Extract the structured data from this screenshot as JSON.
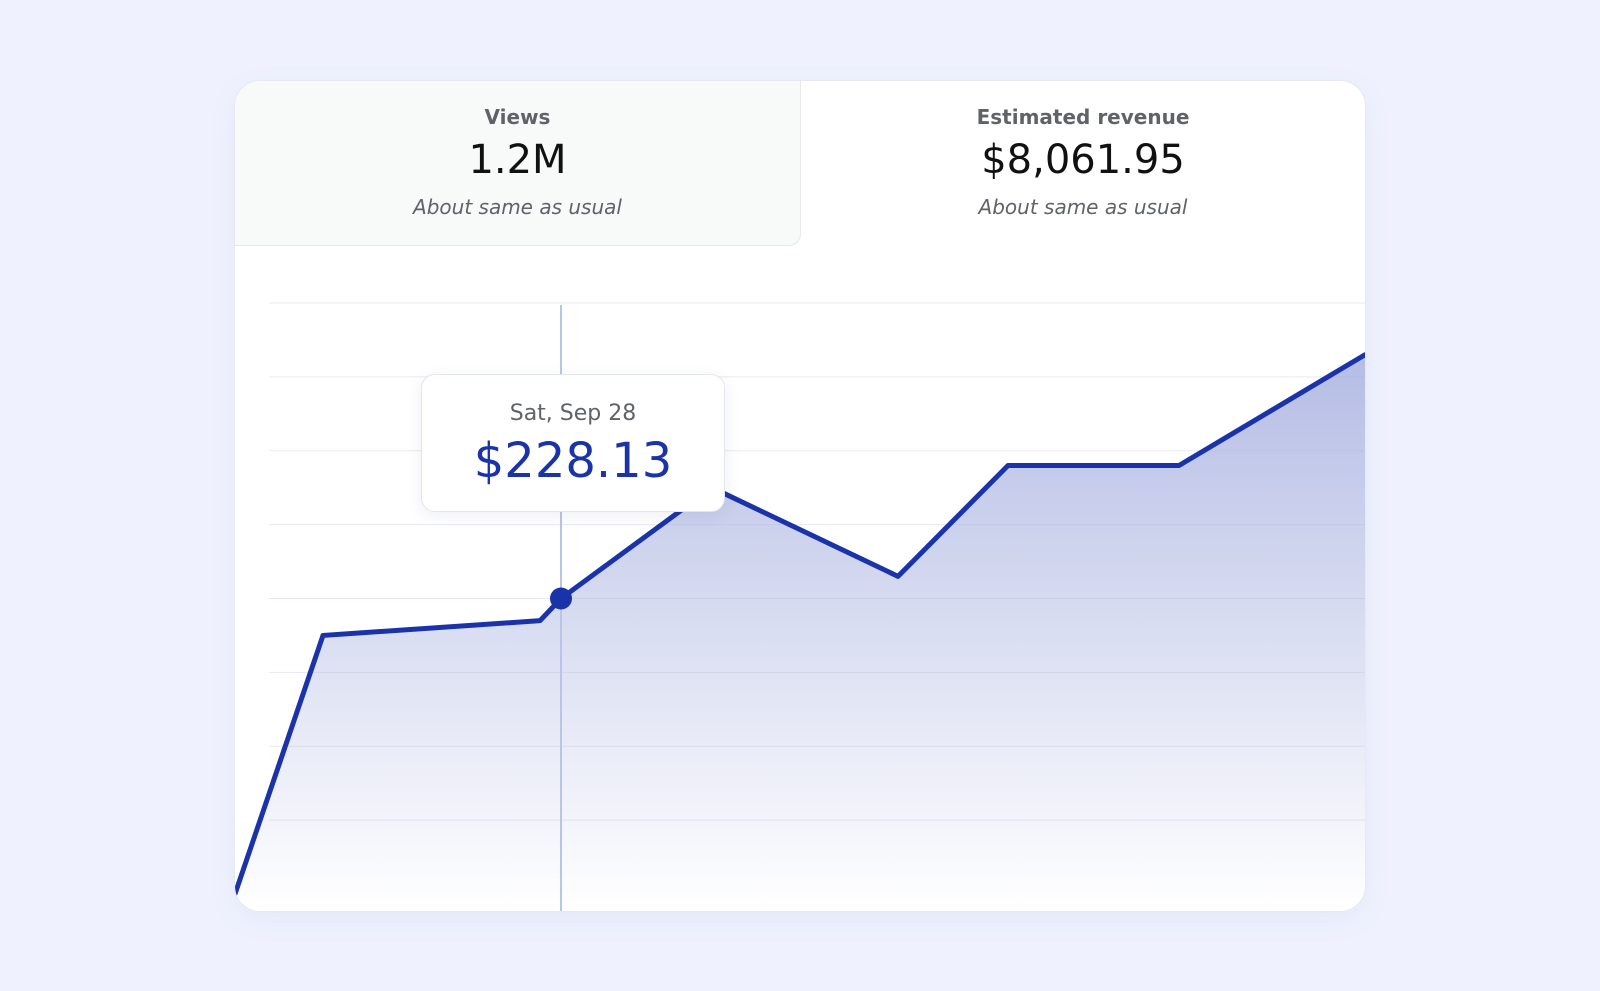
{
  "metrics": {
    "views": {
      "label": "Views",
      "value": "1.2M",
      "sub": "About same as usual"
    },
    "revenue": {
      "label": "Estimated revenue",
      "value": "$8,061.95",
      "sub": "About same as usual"
    }
  },
  "tooltip": {
    "date": "Sat, Sep 28",
    "value": "$228.13"
  },
  "colors": {
    "line": "#1b33a8",
    "area_top": "#a8b1e0",
    "gridline": "#e8eaf1",
    "crosshair": "#b8c4ea",
    "background": "#eff2fe"
  },
  "chart_data": {
    "type": "area",
    "x": [
      0,
      1,
      2,
      3,
      4,
      5,
      6,
      7,
      8
    ],
    "values": [
      0,
      35,
      37,
      40,
      55,
      43,
      58,
      58,
      73
    ],
    "ylim": [
      0,
      80
    ],
    "grid": true,
    "highlight": {
      "index": 3,
      "label": "Sat, Sep 28",
      "value": "$228.13"
    }
  }
}
